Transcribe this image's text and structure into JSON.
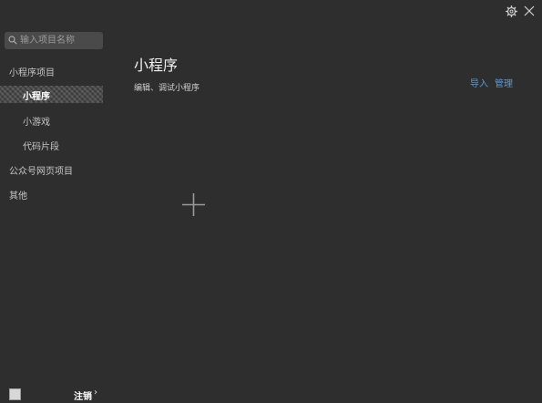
{
  "window": {
    "settings_icon": "gear-icon",
    "close_icon": "close-icon"
  },
  "sidebar": {
    "search": {
      "placeholder": "输入项目名称",
      "value": ""
    },
    "groups": [
      {
        "label": "小程序项目",
        "items": [
          {
            "label": "小程序",
            "active": true
          },
          {
            "label": "小游戏"
          },
          {
            "label": "代码片段"
          }
        ]
      },
      {
        "label": "公众号网页项目",
        "items": []
      },
      {
        "label": "其他",
        "items": []
      }
    ]
  },
  "footer": {
    "logout_label": "注销",
    "chevron": "›"
  },
  "main": {
    "title": "小程序",
    "subtitle": "编辑、调试小程序",
    "actions": {
      "import_label": "导入",
      "manage_label": "管理"
    },
    "add_icon": "plus-icon"
  },
  "colors": {
    "background": "#2e2e2e",
    "search_bg": "#4a4a4a",
    "link": "#5a9ad6"
  }
}
